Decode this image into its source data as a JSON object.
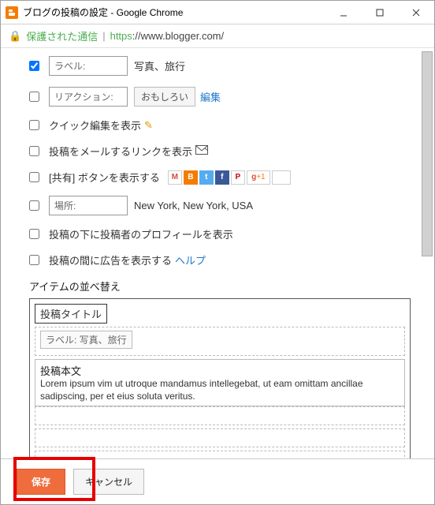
{
  "window": {
    "title": "ブログの投稿の設定 - Google Chrome"
  },
  "url": {
    "secure_label": "保護された通信",
    "https": "https",
    "rest": "://www.blogger.com/"
  },
  "options": {
    "labels_label": "ラベル:",
    "labels_value": "写真、旅行",
    "reaction_label": "リアクション:",
    "reaction_button": "おもしろい",
    "reaction_edit": "編集",
    "quick_edit": "クイック編集を表示",
    "email_post_link": "投稿をメールするリンクを表示",
    "share_buttons": "[共有] ボタンを表示する",
    "location_label": "場所:",
    "location_value": "New York, New York, USA",
    "author_profile": "投稿の下に投稿者のプロフィールを表示",
    "show_ads": "投稿の間に広告を表示する",
    "ads_help": "ヘルプ"
  },
  "arrange": {
    "header": "アイテムの並べ替え",
    "post_title": "投稿タイトル",
    "labels_row": "ラベル: 写真、旅行",
    "body_header": "投稿本文",
    "lorem": "Lorem ipsum vim ut utroque mandamus intellegebat, ut eam omittam ancillae sadipscing, per et eius soluta veritus."
  },
  "buttons": {
    "save": "保存",
    "cancel": "キャンセル"
  }
}
